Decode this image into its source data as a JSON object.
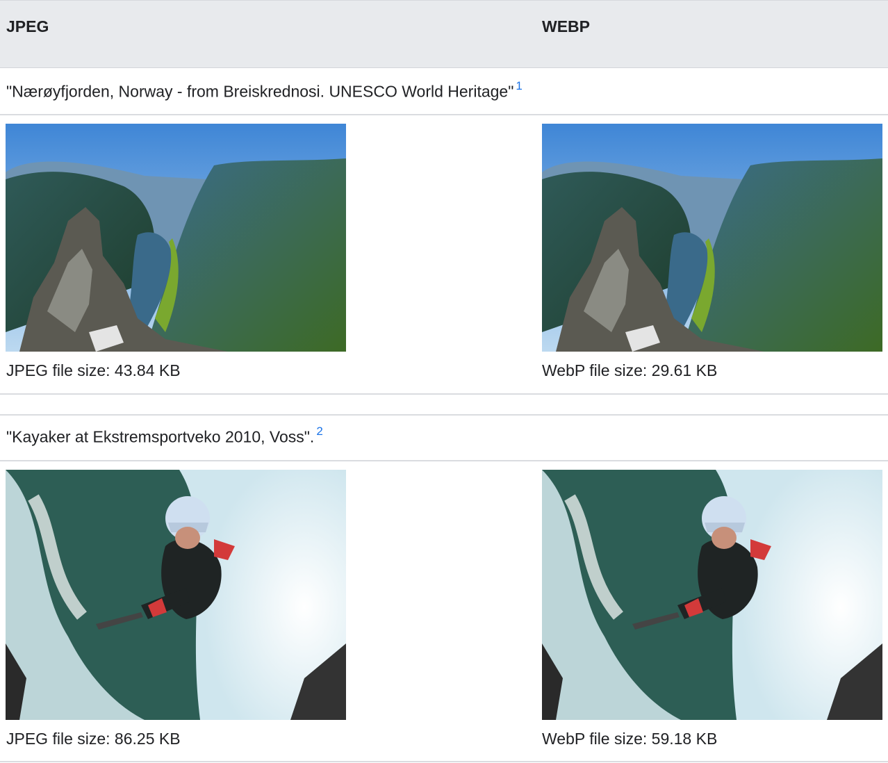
{
  "header": {
    "col_jpeg": "JPEG",
    "col_webp": "WEBP"
  },
  "rows": [
    {
      "caption": "\"Nærøyfjorden, Norway - from Breiskrednosi. UNESCO World Heritage\"",
      "footnote": "1",
      "jpeg_size": "JPEG file size: 43.84 KB",
      "webp_size": "WebP file size: 29.61 KB"
    },
    {
      "caption": "\"Kayaker at Ekstremsportveko 2010, Voss\".",
      "footnote": "2",
      "jpeg_size": "JPEG file size: 86.25 KB",
      "webp_size": "WebP file size: 59.18 KB"
    }
  ],
  "colors": {
    "header_bg": "#e8eaed",
    "link": "#1a73e8",
    "divider": "#dadce0"
  }
}
